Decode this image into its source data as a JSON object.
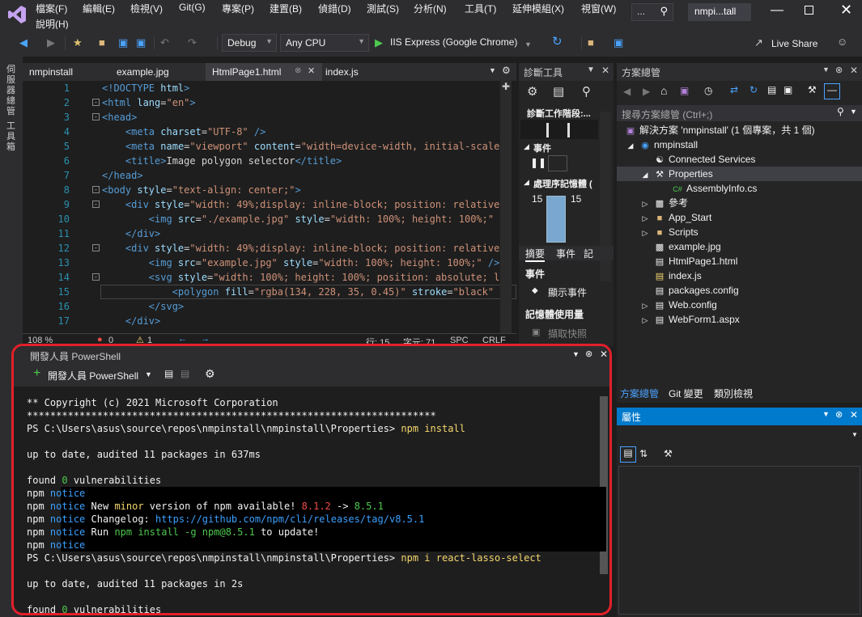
{
  "menu": {
    "items": [
      "檔案(F)",
      "編輯(E)",
      "檢視(V)",
      "Git(G)",
      "專案(P)",
      "建置(B)",
      "偵錯(D)",
      "測試(S)",
      "分析(N)",
      "工具(T)",
      "延伸模組(X)",
      "視窗(W)"
    ],
    "second_row": "說明(H)",
    "search_placeholder": "...",
    "project_name": "nmpi...tall"
  },
  "toolbar": {
    "config": "Debug",
    "platform": "Any CPU",
    "run_target": "IIS Express (Google Chrome)",
    "live_share": "Live Share"
  },
  "left_strip": {
    "item1": "伺服器總管",
    "item2": "工具箱"
  },
  "doc_tabs": [
    {
      "label": "nmpinstall"
    },
    {
      "label": "example.jpg"
    },
    {
      "label": "HtmlPage1.html"
    },
    {
      "label": "index.js"
    }
  ],
  "code": {
    "line_numbers": [
      "1",
      "2",
      "3",
      "4",
      "5",
      "6",
      "7",
      "8",
      "9",
      "10",
      "11",
      "12",
      "13",
      "14",
      "15",
      "16",
      "17"
    ]
  },
  "editor_status": {
    "zoom": "108 %",
    "errors": "0",
    "warnings": "1",
    "line": "行: 15",
    "col": "字元: 71",
    "spc": "SPC",
    "crlf": "CRLF"
  },
  "diagnostics": {
    "title": "診斷工具",
    "session": "診斷工作階段:...",
    "events": "事件",
    "memory": "處理序記憶體 (",
    "mem_left": "15",
    "mem_right": "15",
    "tabs": [
      "摘要",
      "事件",
      "記"
    ],
    "section_events": "事件",
    "show_events": "顯示事件",
    "memory_usage": "記憶體使用量",
    "snapshot": "擷取快照"
  },
  "solution": {
    "title": "方案總管",
    "search_placeholder": "搜尋方案總管 (Ctrl+;)",
    "solution_label": "解決方案 'nmpinstall' (1 個專案，共 1 個)",
    "items": [
      {
        "label": "nmpinstall"
      },
      {
        "label": "Connected Services"
      },
      {
        "label": "Properties"
      },
      {
        "label": "AssemblyInfo.cs"
      },
      {
        "label": "參考"
      },
      {
        "label": "App_Start"
      },
      {
        "label": "Scripts"
      },
      {
        "label": "example.jpg"
      },
      {
        "label": "HtmlPage1.html"
      },
      {
        "label": "index.js"
      },
      {
        "label": "packages.config"
      },
      {
        "label": "Web.config"
      },
      {
        "label": "WebForm1.aspx"
      }
    ],
    "bottom_tabs": [
      "方案總管",
      "Git 變更",
      "類別檢視"
    ]
  },
  "properties": {
    "title": "屬性"
  },
  "powershell": {
    "title": "開發人員 PowerShell",
    "dropdown": "開發人員 PowerShell",
    "prompt": "PS C:\\Users\\asus\\source\\repos\\nmpinstall\\nmpinstall\\Properties>",
    "cmd1": "npm install",
    "cmd2": "npm i react-lasso-select",
    "copyright": "** Copyright (c) 2021 Microsoft Corporation",
    "stars": "**********************************************************************",
    "uptodate1": "up to date, audited 11 packages in 637ms",
    "uptodate2": "up to date, audited 11 packages in 2s",
    "found": "found",
    "zero": "0",
    "vuln": "vulnerabilities",
    "npm": "npm",
    "notice": "notice",
    "new_msg": "New",
    "minor": "minor",
    "version_msg": "version of npm available!",
    "v_old": "8.1.2",
    "arrow": "->",
    "v_new": "8.5.1",
    "changelog": "Changelog:",
    "changelog_url": "https://github.com/npm/cli/releases/tag/v8.5.1",
    "run": "Run",
    "run_cmd": "npm install -g npm@8.5.1",
    "to_update": "to update!"
  }
}
